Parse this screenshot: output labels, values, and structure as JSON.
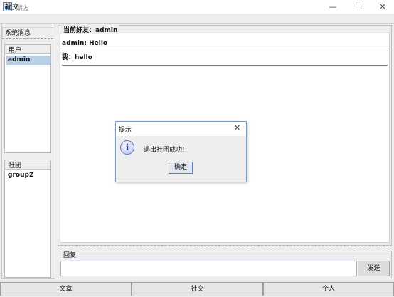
{
  "window": {
    "title": "朋友",
    "icon": "app-window-icon",
    "min_glyph": "—",
    "max_glyph": "☐",
    "close_glyph": "✕"
  },
  "menubar": {
    "items": [
      "社交"
    ]
  },
  "sidebar": {
    "system_messages_label": "系统消息",
    "users": {
      "header": "用户",
      "items": [
        "admin"
      ],
      "selected": "admin"
    },
    "groups": {
      "header": "社团",
      "items": [
        "group2"
      ]
    }
  },
  "chat": {
    "title": "当前好友：admin",
    "messages": [
      "admin: Hello",
      "我：hello"
    ]
  },
  "reply": {
    "label": "回复",
    "input_value": "",
    "send_label": "发送"
  },
  "bottom_tabs": [
    "文章",
    "社交",
    "个人"
  ],
  "dialog": {
    "title": "提示",
    "close_glyph": "✕",
    "icon": "info-icon",
    "icon_glyph": "i",
    "message": "退出社团成功!",
    "ok_label": "确定"
  },
  "colors": {
    "selection": "#b8cfe5",
    "message_underline": "#6a7fb1",
    "dialog_border": "#7e9cc1"
  }
}
